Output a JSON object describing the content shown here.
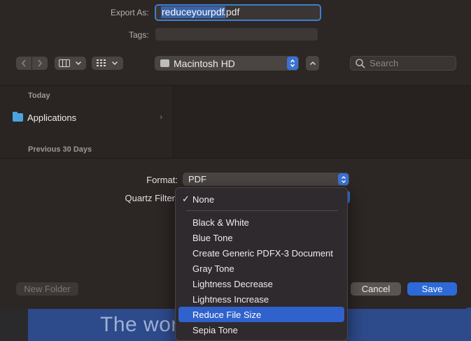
{
  "background_document": {
    "visible_text": "The wor"
  },
  "dialog": {
    "export_as_label": "Export As:",
    "filename_selected": "reduceyourpdf",
    "filename_extension": ".pdf",
    "tags_label": "Tags:",
    "location": "Macintosh HD",
    "search_placeholder": "Search",
    "sidebar": {
      "sections": [
        {
          "title": "Today",
          "items": [
            {
              "label": "Applications",
              "chevron": "›"
            }
          ]
        },
        {
          "title": "Previous 30 Days",
          "items": []
        }
      ]
    },
    "format_label": "Format:",
    "format_value": "PDF",
    "quartz_filter_label": "Quartz Filter",
    "buttons": {
      "new_folder": "New Folder",
      "cancel": "Cancel",
      "save": "Save"
    }
  },
  "quartz_menu": {
    "selected": "None",
    "highlighted": "Reduce File Size",
    "items": [
      "None",
      "Black & White",
      "Blue Tone",
      "Create Generic PDFX-3 Document",
      "Gray Tone",
      "Lightness Decrease",
      "Lightness Increase",
      "Reduce File Size",
      "Sepia Tone"
    ]
  },
  "colors": {
    "accent": "#2d6ad8",
    "highlight": "#2f62cc",
    "folder": "#4aa4e0"
  }
}
